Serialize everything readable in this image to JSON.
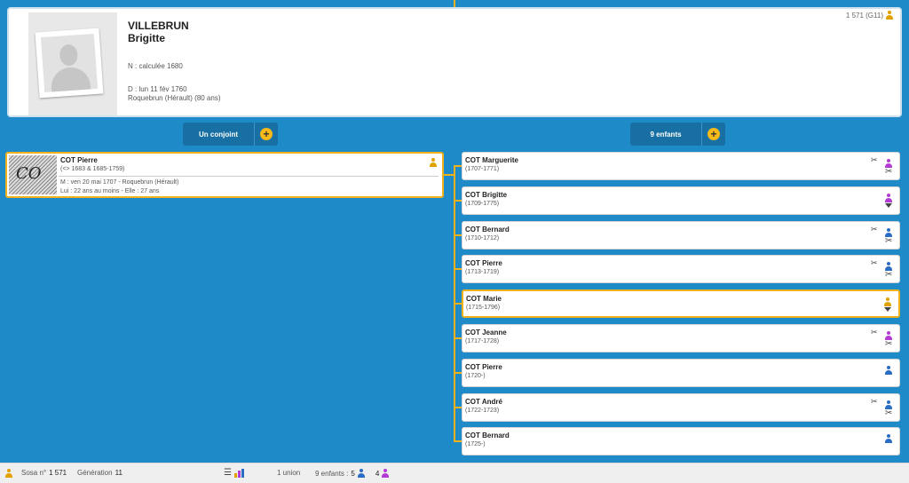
{
  "main_person": {
    "surname": "VILLEBRUN",
    "given_name": "Brigitte",
    "birth": "N : calculée 1680",
    "death": "D : lun 11 fév 1760",
    "death_place": "Roquebrun (Hérault) (80 ans)",
    "sosa": "1 571 (G11)"
  },
  "spouse_button": {
    "label": "Un conjoint",
    "plus": "+"
  },
  "children_button": {
    "label": "9 enfants",
    "plus": "+"
  },
  "spouse": {
    "signature": "CO",
    "name": "COT Pierre",
    "dates": "(<> 1683 & 1685-1759)",
    "marriage": "M : ven 20 mai 1707 - Roquebrun (Hérault)",
    "ages": "Lui : 22 ans au moins - Elle : 27 ans"
  },
  "children": [
    {
      "name": "COT Marguerite",
      "dates": "(1707-1771)",
      "sex": "female",
      "icons": [
        "scissors-cross",
        "female",
        "scissors"
      ]
    },
    {
      "name": "COT Brigitte",
      "dates": "(1709-1775)",
      "sex": "female",
      "icons": [
        "female",
        "caret"
      ]
    },
    {
      "name": "COT Bernard",
      "dates": "(1710-1712)",
      "sex": "male",
      "icons": [
        "scissors-cross",
        "male",
        "scissors"
      ]
    },
    {
      "name": "COT Pierre",
      "dates": "(1713-1719)",
      "sex": "male",
      "icons": [
        "scissors-cross",
        "male",
        "scissors"
      ]
    },
    {
      "name": "COT Marie",
      "dates": "(1715-1796)",
      "sex": "female",
      "selected": true,
      "icons": [
        "gold",
        "caret"
      ]
    },
    {
      "name": "COT Jeanne",
      "dates": "(1717-1728)",
      "sex": "female",
      "icons": [
        "scissors-cross",
        "female",
        "scissors"
      ]
    },
    {
      "name": "COT Pierre",
      "dates": "(1720-)",
      "sex": "male",
      "icons": [
        "male"
      ]
    },
    {
      "name": "COT André",
      "dates": "(1722-1723)",
      "sex": "male",
      "icons": [
        "scissors-cross",
        "male",
        "scissors"
      ]
    },
    {
      "name": "COT Bernard",
      "dates": "(1725-)",
      "sex": "male",
      "icons": [
        "male"
      ]
    }
  ],
  "footer": {
    "sosa_label": "Sosa n°",
    "sosa_value": "1 571",
    "generation_label": "Génération",
    "generation_value": "11",
    "unions": "1 union",
    "children_label": "9 enfants :",
    "male_count": "5",
    "female_count": "4"
  },
  "colors": {
    "background": "#1e8bc8",
    "accent": "#f0b21c",
    "button": "#176fa3",
    "male": "#2b6cc4",
    "female": "#b43ad4"
  }
}
